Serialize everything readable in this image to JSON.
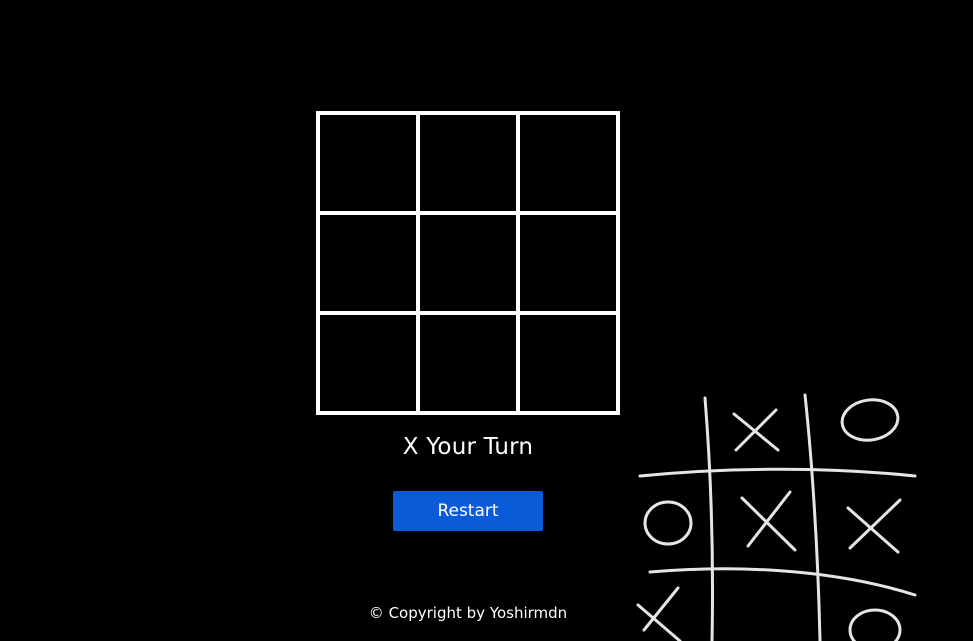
{
  "game": {
    "board": {
      "cells": [
        "",
        "",
        "",
        "",
        "",
        "",
        "",
        "",
        ""
      ]
    },
    "status_text": "X Your Turn",
    "restart_label": "Restart",
    "footer_text": "© Copyright by Yoshirmdn"
  },
  "decoration": {
    "name": "tic-tac-toe-chalk-illustration"
  },
  "colors": {
    "background": "#000000",
    "grid_line": "#ffffff",
    "button": "#0b5bd8",
    "text": "#ffffff"
  }
}
